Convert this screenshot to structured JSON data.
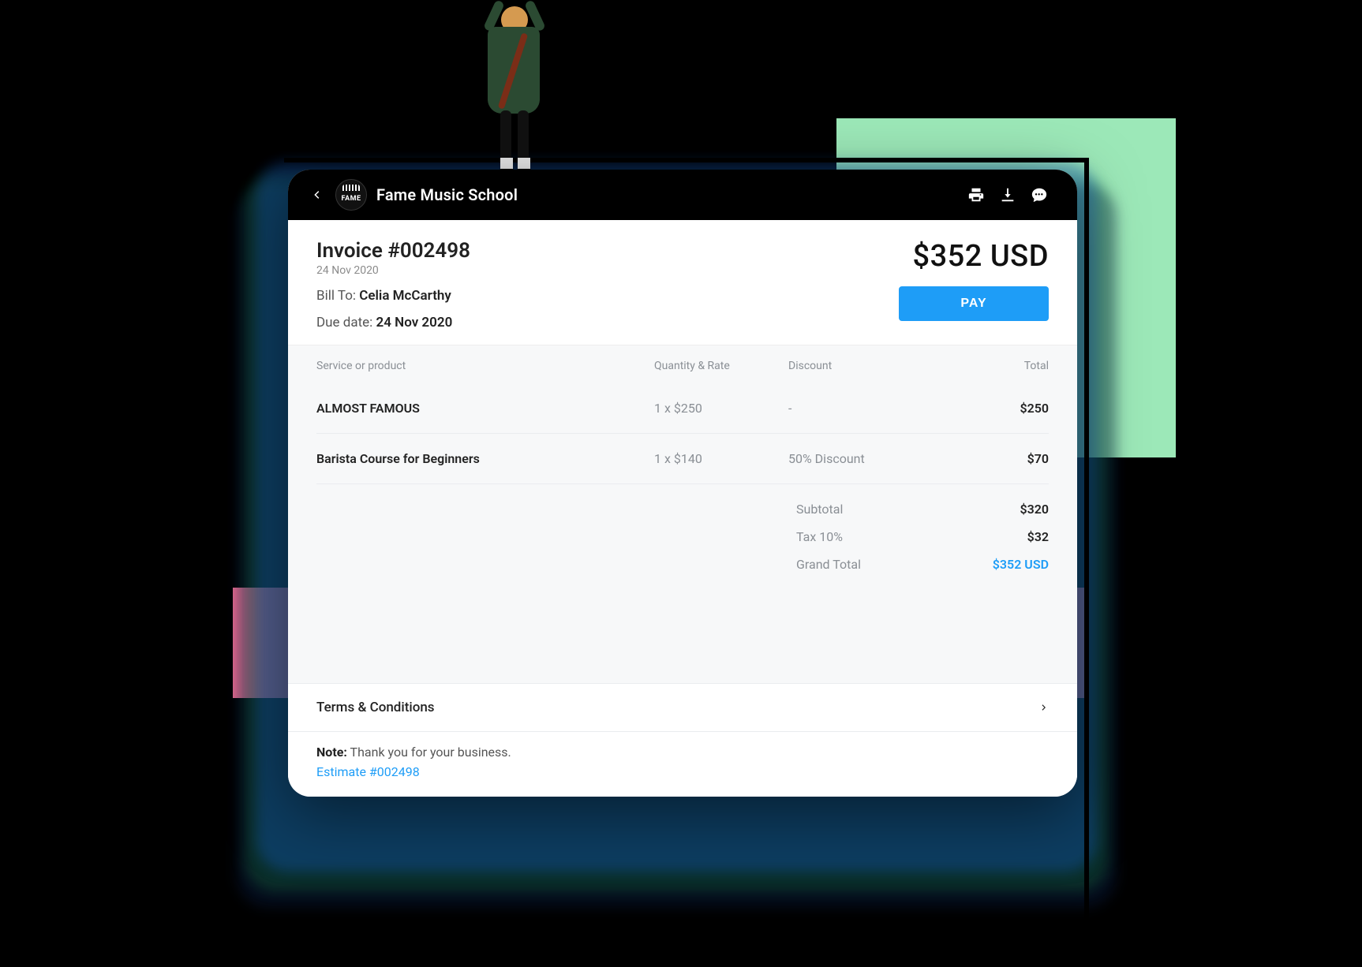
{
  "header": {
    "logo_text": "FAME",
    "title": "Fame Music School",
    "icons": {
      "back": "chevron-left-icon",
      "print": "print-icon",
      "download": "download-icon",
      "chat": "chat-icon"
    }
  },
  "invoice": {
    "title": "Invoice #002498",
    "date": "24 Nov 2020",
    "bill_to_label": "Bill To:",
    "bill_to_value": "Celia McCarthy",
    "due_label": "Due date:",
    "due_value": "24 Nov 2020",
    "amount_display": "$352 USD",
    "pay_label": "PAY"
  },
  "table": {
    "columns": {
      "service": "Service or product",
      "qty_rate": "Quantity & Rate",
      "discount": "Discount",
      "total": "Total"
    },
    "rows": [
      {
        "service": "ALMOST FAMOUS",
        "qty_rate": "1 x $250",
        "discount": "-",
        "total": "$250"
      },
      {
        "service": "Barista Course for Beginners",
        "qty_rate": "1 x $140",
        "discount": "50% Discount",
        "total": "$70"
      }
    ]
  },
  "summary": {
    "subtotal_label": "Subtotal",
    "subtotal_value": "$320",
    "tax_label": "Tax 10%",
    "tax_value": "$32",
    "grand_label": "Grand Total",
    "grand_value": "$352 USD"
  },
  "footer": {
    "terms_label": "Terms & Conditions",
    "note_label": "Note:",
    "note_text": "Thank you for your business.",
    "estimate_link": "Estimate #002498"
  }
}
